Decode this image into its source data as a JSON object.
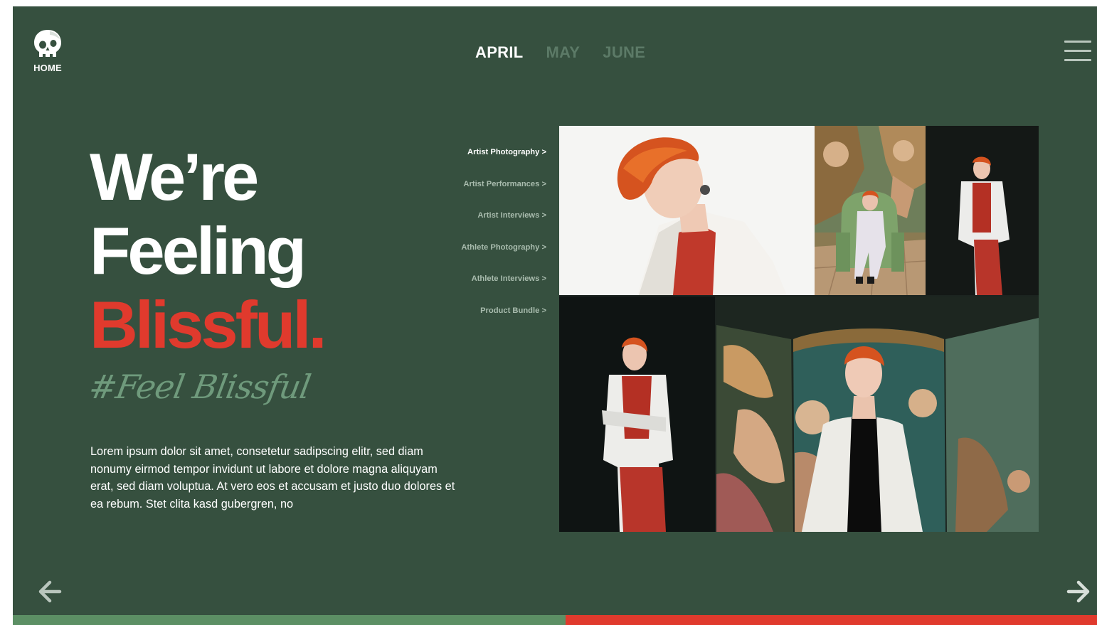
{
  "header": {
    "home_label": "HOME",
    "logo_icon": "skull-icon",
    "months": [
      {
        "label": "APRIL",
        "active": true
      },
      {
        "label": "MAY",
        "active": false
      },
      {
        "label": "JUNE",
        "active": false
      }
    ],
    "menu_icon": "hamburger-menu-icon"
  },
  "hero": {
    "line1": "We’re",
    "line2": "Feeling",
    "line3": "Blissful.",
    "hashtag": "#Feel Blissful",
    "body": "Lorem ipsum dolor sit amet, consetetur sadipscing elitr, sed diam nonumy eirmod tempor invidunt ut labore et dolore magna aliquyam erat, sed diam voluptua. At vero eos et accusam et justo duo dolores et ea rebum. Stet clita kasd gubergren, no"
  },
  "categories": [
    {
      "label": "Artist Photography >",
      "active": true
    },
    {
      "label": "Artist Performances >",
      "active": false
    },
    {
      "label": "Artist Interviews >",
      "active": false
    },
    {
      "label": "Athlete Photography >",
      "active": false
    },
    {
      "label": "Athlete Interviews >",
      "active": false
    },
    {
      "label": "Product Bundle >",
      "active": false
    }
  ],
  "gallery": {
    "photos": [
      {
        "name": "photo-portrait-white-background"
      },
      {
        "name": "photo-seated-armchair-fresco"
      },
      {
        "name": "photo-standing-dark-background"
      },
      {
        "name": "photo-standing-full-length"
      },
      {
        "name": "photo-fresco-screen-portrait"
      }
    ]
  },
  "navigation": {
    "prev_icon": "arrow-left-icon",
    "next_icon": "arrow-right-icon"
  },
  "progress": {
    "fraction": 0.51
  },
  "colors": {
    "background": "#36503f",
    "accent_red": "#e03a2d",
    "progress_green": "#5c8f64",
    "hashtag_green": "#6f9a7c",
    "inactive_tab": "#5c7a67"
  }
}
